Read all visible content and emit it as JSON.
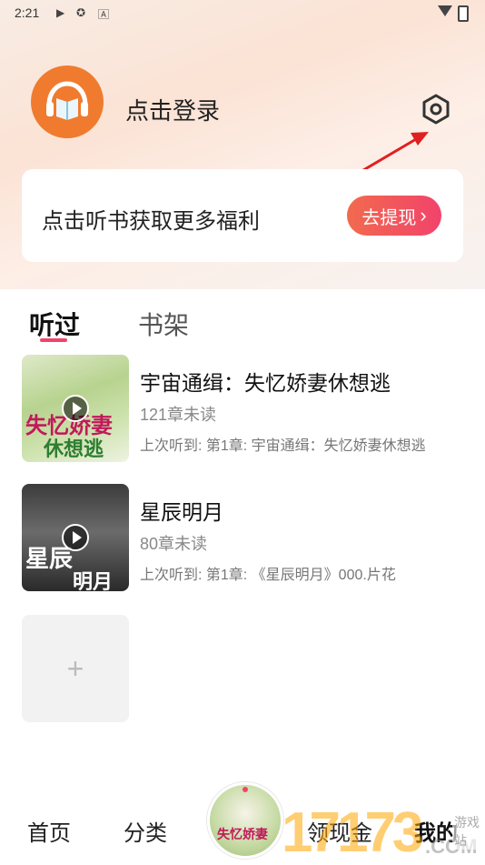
{
  "status_bar": {
    "time": "2:21",
    "icons": [
      "play-icon",
      "app-icon",
      "a-icon"
    ],
    "signal": "wifi-icon",
    "battery": "battery-icon"
  },
  "profile": {
    "login_label": "点击登录",
    "avatar_icon": "headphone-book-icon",
    "settings_icon": "hexagon-settings-icon"
  },
  "promo": {
    "text": "点击听书获取更多福利",
    "button_label": "去提现",
    "button_chevron": "›"
  },
  "tabs": [
    {
      "label": "听过",
      "active": true
    },
    {
      "label": "书架",
      "active": false
    }
  ],
  "books": [
    {
      "title": "宇宙通缉：失忆娇妻休想逃",
      "unread": "121章未读",
      "last": "上次听到: 第1章: 宇宙通缉：失忆娇妻休想逃",
      "cover_text_top": "失忆娇妻",
      "cover_text_bottom": "休想逃"
    },
    {
      "title": "星辰明月",
      "unread": "80章未读",
      "last": "上次听到: 第1章: 《星辰明月》000.片花",
      "cover_text_top": "星辰",
      "cover_text_bottom": "明月"
    }
  ],
  "add_button": "+",
  "bottom_nav": {
    "home": "首页",
    "category": "分类",
    "gold": "领现金",
    "mine": "我的",
    "center_cover_text": "失忆娇妻"
  },
  "watermark": {
    "numbers": "17173",
    "com": ".COM",
    "site": "游戏站"
  },
  "colors": {
    "accent": "#f2436b",
    "avatar": "#f07b2e"
  }
}
